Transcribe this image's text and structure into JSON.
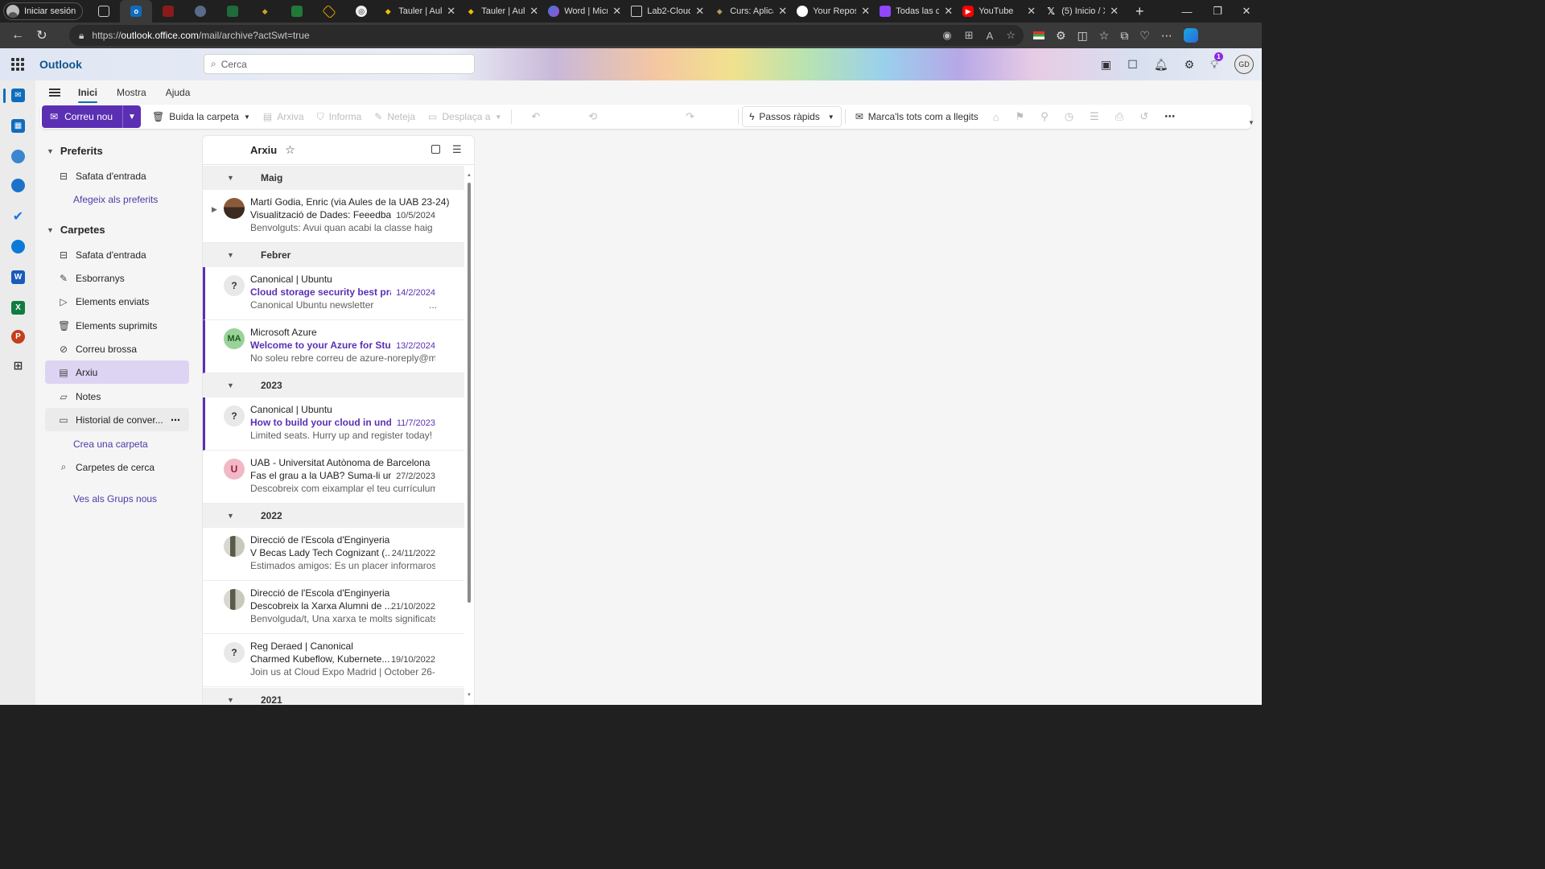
{
  "browser": {
    "signin_label": "Iniciar sesión",
    "tabs": [
      {
        "title": "Tauler | Aule",
        "icon": "diamond-icon"
      },
      {
        "title": "Tauler | Aule",
        "icon": "diamond-icon"
      },
      {
        "title": "Word | Micro",
        "icon": "copilot-icon"
      },
      {
        "title": "Lab2-Cloud",
        "icon": "document-icon"
      },
      {
        "title": "Curs: Aplica",
        "icon": "diamond-icon"
      },
      {
        "title": "Your Reposi",
        "icon": "github-icon"
      },
      {
        "title": "Todas las ca",
        "icon": "twitch-icon"
      },
      {
        "title": "YouTube",
        "icon": "youtube-icon"
      },
      {
        "title": "(5) Inicio / X",
        "icon": "x-icon"
      }
    ],
    "url_prefix": "https://",
    "url_host": "outlook.office.com",
    "url_path": "/mail/archive?actSwt=true"
  },
  "app": {
    "name": "Outlook",
    "search_placeholder": "Cerca",
    "avatar_initials": "GD",
    "notification_count": "1"
  },
  "ribbon_tabs": [
    "Inici",
    "Mostra",
    "Ajuda"
  ],
  "toolbar": {
    "new_mail": "Correu nou",
    "empty_folder": "Buida la carpeta",
    "archive": "Arxiva",
    "report": "Informa",
    "sweep": "Neteja",
    "move_to": "Desplaça a",
    "quick_steps": "Passos ràpids",
    "mark_all_read": "Marca'ls tots com a llegits"
  },
  "folders": {
    "favorites_title": "Preferits",
    "favorites": [
      "Safata d'entrada"
    ],
    "add_favorite": "Afegeix als preferits",
    "folders_title": "Carpetes",
    "items": [
      "Safata d'entrada",
      "Esborranys",
      "Elements enviats",
      "Elements suprimits",
      "Correu brossa",
      "Arxiu",
      "Notes",
      "Historial de conver..."
    ],
    "create_folder": "Crea una carpeta",
    "search_folders": "Carpetes de cerca",
    "groups_link": "Ves als Grups nous"
  },
  "message_list": {
    "title": "Arxiu",
    "groups": [
      {
        "label": "Maig"
      },
      {
        "label": "Febrer"
      },
      {
        "label": "2023"
      },
      {
        "label": "2022"
      },
      {
        "label": "2021"
      }
    ],
    "messages": [
      {
        "from": "Martí Godia, Enric (via Aules de la UAB 23-24)",
        "subject": "Visualització de Dades: Feeedba...",
        "date": "10/5/2024",
        "preview": "Benvolguts: Avui quan acabi la classe haig d...",
        "avatar": "",
        "unread": false
      },
      {
        "from": "Canonical | Ubuntu",
        "subject": "Cloud storage security best pra...",
        "date": "14/2/2024",
        "preview": "Canonical Ubuntu newsletter",
        "preview_tail": "...",
        "avatar": "?",
        "unread": true
      },
      {
        "from": "Microsoft Azure",
        "subject": "Welcome to your Azure for Stu...",
        "date": "13/2/2024",
        "preview": "No soleu rebre correu de azure-noreply@m...",
        "avatar": "MA",
        "unread": true
      },
      {
        "from": "Canonical | Ubuntu",
        "subject": "How to build your cloud in und...",
        "date": "11/7/2023",
        "preview": "Limited seats. Hurry up and register today! ...",
        "avatar": "?",
        "unread": true
      },
      {
        "from": "UAB - Universitat Autònoma de Barcelona",
        "subject": "Fas el grau a la UAB? Suma-li un...",
        "date": "27/2/2023",
        "preview": "Descobreix com eixamplar el teu currículum...",
        "avatar": "U",
        "unread": false
      },
      {
        "from": "Direcció de l'Escola d'Enginyeria",
        "subject": "V Becas Lady Tech Cognizant (...",
        "date": "24/11/2022",
        "preview": "Estimados amigos: Es un placer informaros ...",
        "avatar": "",
        "unread": false
      },
      {
        "from": "Direcció de l'Escola d'Enginyeria",
        "subject": "Descobreix la Xarxa Alumni de ...",
        "date": "21/10/2022",
        "preview": "Benvolguda/t, Una xarxa te molts significats...",
        "avatar": "",
        "unread": false
      },
      {
        "from": "Reg Deraed | Canonical",
        "subject": "Charmed Kubeflow, Kubernete...",
        "date": "19/10/2022",
        "preview": "Join us at Cloud Expo Madrid | October 26-...",
        "avatar": "?",
        "unread": false
      }
    ]
  }
}
